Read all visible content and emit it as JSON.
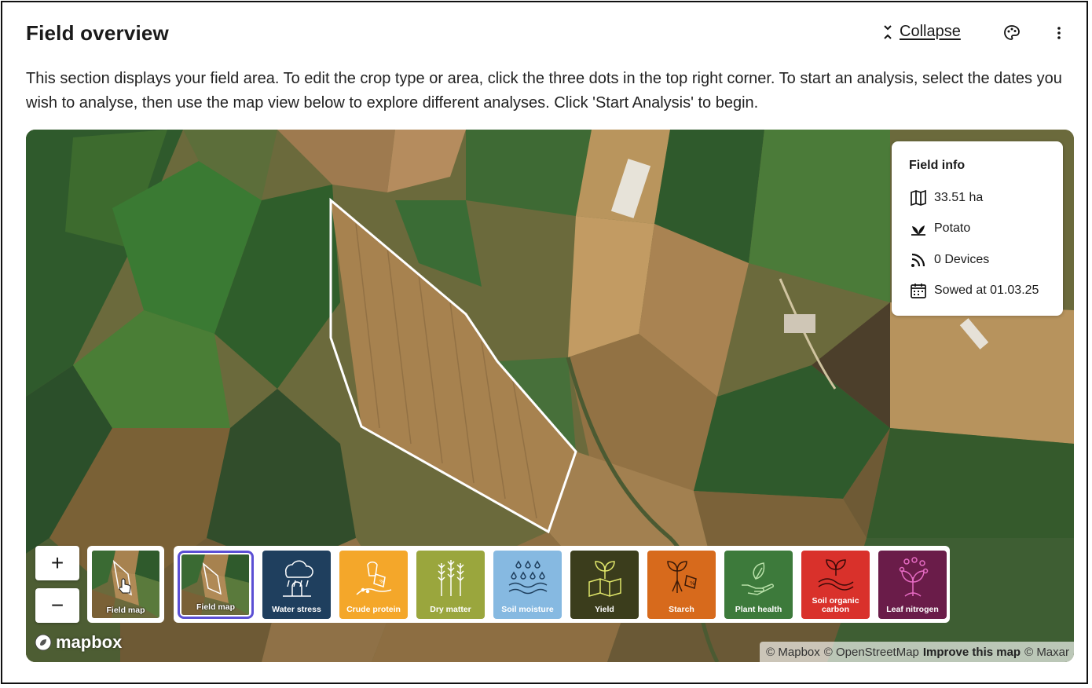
{
  "header": {
    "title": "Field overview",
    "collapse_label": "Collapse"
  },
  "description": "This section displays your field area. To edit the crop type or area, click the three dots in the top right corner. To start an analysis, select the dates you wish to analyse, then use the map view below to explore different analyses. Click 'Start Analysis' to begin.",
  "field_info": {
    "title": "Field info",
    "area": "33.51 ha",
    "crop": "Potato",
    "devices": "0 Devices",
    "sowed": "Sowed at 01.03.25"
  },
  "map_controls": {
    "zoom_in": "+",
    "zoom_out": "−",
    "basemap_label": "Field map"
  },
  "analyses": [
    {
      "label": "Field map",
      "color": "#5f6b3a",
      "icon": "field-map-icon"
    },
    {
      "label": "Water stress",
      "color": "#1f3f5e",
      "icon": "water-stress-icon"
    },
    {
      "label": "Crude protein",
      "color": "#f4a72a",
      "icon": "crude-protein-icon"
    },
    {
      "label": "Dry matter",
      "color": "#9aa63d",
      "icon": "dry-matter-icon"
    },
    {
      "label": "Soil moisture",
      "color": "#86b9e1",
      "icon": "soil-moisture-icon"
    },
    {
      "label": "Yield",
      "color": "#3b3d1c",
      "icon": "yield-icon"
    },
    {
      "label": "Starch",
      "color": "#d76a1c",
      "icon": "starch-icon"
    },
    {
      "label": "Plant health",
      "color": "#3d7a3b",
      "icon": "plant-health-icon"
    },
    {
      "label": "Soil organic carbon",
      "color": "#d9312b",
      "icon": "soil-organic-carbon-icon"
    },
    {
      "label": "Leaf nitrogen",
      "color": "#6a1c49",
      "icon": "leaf-nitrogen-icon"
    }
  ],
  "attribution": {
    "mapbox": "© Mapbox",
    "osm": "© OpenStreetMap",
    "improve": "Improve this map",
    "maxar": "© Maxar"
  },
  "logo": "mapbox"
}
